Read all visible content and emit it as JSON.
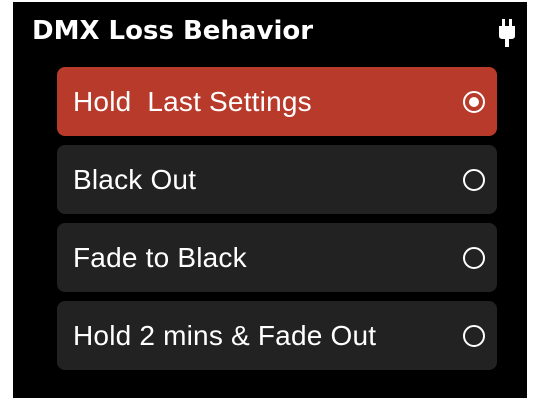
{
  "screen": {
    "title": "DMX Loss Behavior",
    "status_icon": "power-plug-icon"
  },
  "options": [
    {
      "label": "Hold  Last Settings",
      "selected": true
    },
    {
      "label": "Black Out",
      "selected": false
    },
    {
      "label": "Fade to Black",
      "selected": false
    },
    {
      "label": "Hold 2 mins & Fade Out",
      "selected": false
    }
  ],
  "colors": {
    "background": "#000000",
    "selected_item": "#b83a2b",
    "item": "#222222",
    "text": "#ffffff"
  }
}
